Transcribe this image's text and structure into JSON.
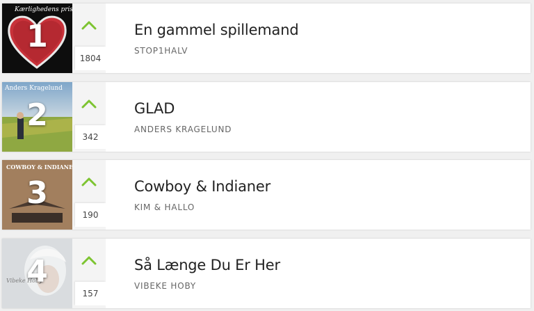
{
  "colors": {
    "accent": "#7dc431",
    "card": "#ffffff",
    "vote_bg": "#f4f4f4",
    "title_text": "#222222",
    "artist_text": "#666666"
  },
  "icons": {
    "upvote": "chevron-up-icon"
  },
  "chart": [
    {
      "rank": "1",
      "votes": "1804",
      "title": "En gammel spillemand",
      "artist": "STOP1HALV",
      "cover_text": "Kærlighedens pris"
    },
    {
      "rank": "2",
      "votes": "342",
      "title": "GLAD",
      "artist": "ANDERS KRAGELUND",
      "cover_text": "Anders Kragelund"
    },
    {
      "rank": "3",
      "votes": "190",
      "title": "Cowboy & Indianer",
      "artist": "KIM & HALLO",
      "cover_text": "COWBOY & INDIANER"
    },
    {
      "rank": "4",
      "votes": "157",
      "title": "Så Længe Du Er Her",
      "artist": "VIBEKE HOBY",
      "cover_text": "Vibeke Hoby"
    }
  ]
}
